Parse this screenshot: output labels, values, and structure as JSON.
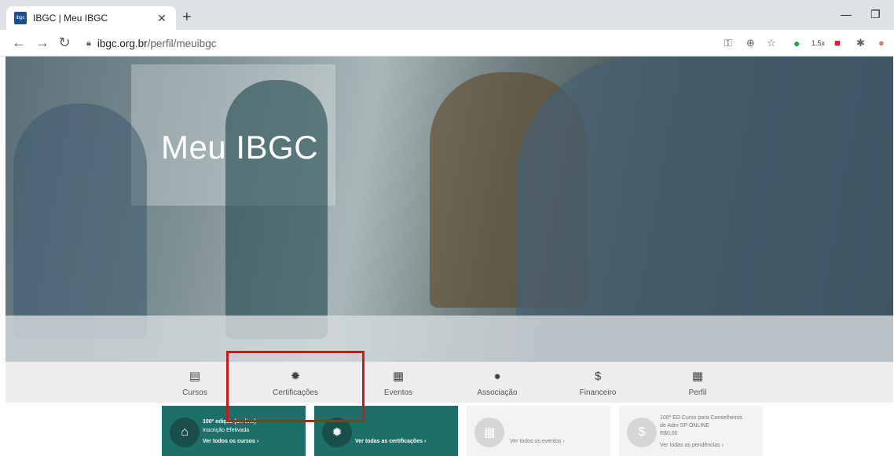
{
  "browser": {
    "tab_title": "IBGC | Meu IBGC",
    "favicon_text": "ibgc",
    "url_host": "ibgc.org.br",
    "url_path": "/perfil/meuibgc",
    "zoom_badge": "1.5x",
    "icons": [
      "back-icon",
      "forward-icon",
      "reload-icon",
      "lock-icon",
      "key-icon",
      "zoom-icon",
      "star-icon",
      "extension-icon",
      "profile-icon"
    ]
  },
  "hero": {
    "title": "Meu IBGC"
  },
  "nav": {
    "items": [
      {
        "label": "Cursos",
        "icon": "▤"
      },
      {
        "label": "Certificações",
        "icon": "✹"
      },
      {
        "label": "Eventos",
        "icon": "▦"
      },
      {
        "label": "Associação",
        "icon": "●"
      },
      {
        "label": "Financeiro",
        "icon": "$"
      },
      {
        "label": "Perfil",
        "icon": "▦"
      }
    ]
  },
  "cards": [
    {
      "line1": "100º edição (on-line)",
      "line2": "Inscrição Efetivada",
      "link": "Ver todos os cursos ›",
      "icon": "⌂"
    },
    {
      "link": "Ver todas as certificações ›",
      "icon": "✹"
    },
    {
      "link": "Ver todos os eventos ›",
      "icon": "▦"
    },
    {
      "line1": "100º ED Curso para Conselheiros",
      "line2": "de Adm SP ONLINE",
      "line3": "R$0,00",
      "link": "Ver todas as pendências ›",
      "icon": "$"
    }
  ],
  "colors": {
    "accent_teal": "#1d7069",
    "highlight_red": "#c81a1a"
  }
}
